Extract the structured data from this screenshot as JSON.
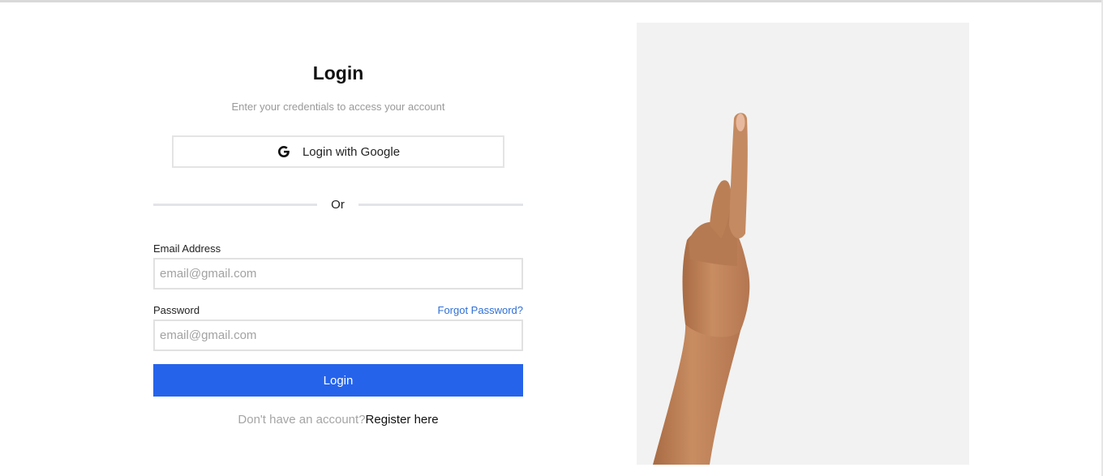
{
  "login": {
    "title": "Login",
    "subtitle": "Enter your credentials to access your account",
    "google_button": {
      "label": "Login with Google",
      "icon": "google-g-icon"
    },
    "divider_text": "Or",
    "email": {
      "label": "Email Address",
      "placeholder": "email@gmail.com",
      "value": ""
    },
    "password": {
      "label": "Password",
      "placeholder": "email@gmail.com",
      "value": ""
    },
    "forgot_password": "Forgot Password?",
    "submit_label": "Login",
    "register_prompt": "Don't have an account?",
    "register_link": "Register here"
  },
  "illustration": {
    "subject": "hand pointing up"
  },
  "colors": {
    "primary": "#2563eb",
    "link": "#2f6fd6",
    "muted_text": "#9a9a9a",
    "panel_bg": "#f2f2f2",
    "skin": "#c98d62"
  }
}
